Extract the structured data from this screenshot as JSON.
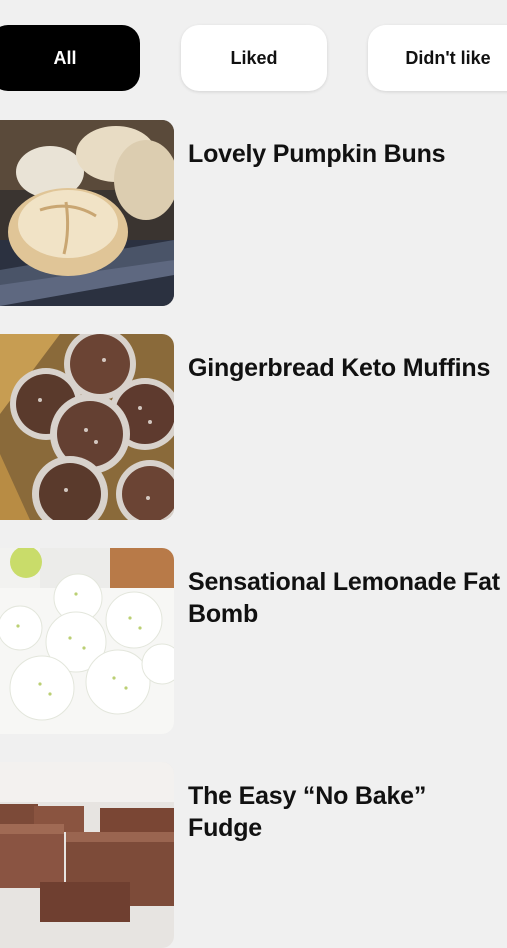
{
  "filters": {
    "all_label": "All",
    "liked_label": "Liked",
    "disliked_label": "Didn't like",
    "selected": "All"
  },
  "recipes": [
    {
      "title": "Lovely Pumpkin Buns",
      "image": "pumpkin-buns-photo"
    },
    {
      "title": "Gingerbread Keto Muffins",
      "image": "gingerbread-muffins-photo"
    },
    {
      "title": "Sensational Lemonade Fat Bomb",
      "image": "lemonade-fat-bomb-photo"
    },
    {
      "title": "The Easy “No Bake” Fudge",
      "image": "no-bake-fudge-photo"
    }
  ],
  "colors": {
    "background": "#f0f0f0",
    "chip_selected_bg": "#000000",
    "chip_bg": "#ffffff"
  }
}
